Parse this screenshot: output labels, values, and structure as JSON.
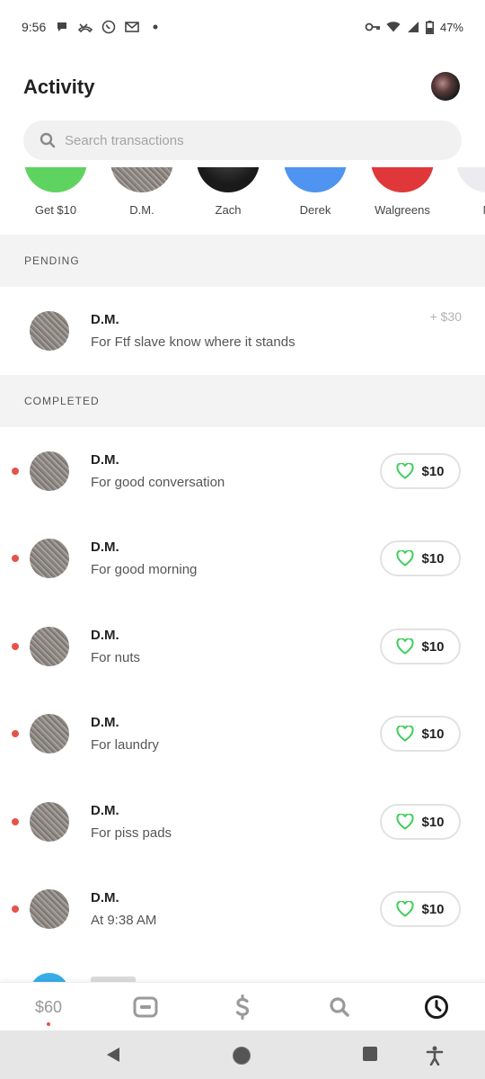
{
  "status_bar": {
    "time": "9:56",
    "battery": "47%",
    "left_icons": [
      "chat-bubble-icon",
      "missed-call-icon",
      "whatsapp-icon",
      "gmail-icon",
      "dot-icon"
    ],
    "right_icons": [
      "vpn-key-icon",
      "wifi-icon",
      "cell-signal-icon",
      "battery-icon"
    ]
  },
  "header": {
    "title": "Activity"
  },
  "search": {
    "placeholder": "Search transactions"
  },
  "contacts": [
    {
      "name": "Get $10",
      "color": "#5fd35f"
    },
    {
      "name": "D.M.",
      "color": "#8f8a86"
    },
    {
      "name": "Zach",
      "color": "#1a1a1a"
    },
    {
      "name": "Derek",
      "color": "#4f94f0"
    },
    {
      "name": "Walgreens",
      "color": "#e0383a"
    },
    {
      "name": "M",
      "color": "#ececf0"
    }
  ],
  "pending": {
    "header": "PENDING",
    "items": [
      {
        "name": "D.M.",
        "memo": "For Ftf slave know where it stands",
        "amount": "+ $30"
      }
    ]
  },
  "completed": {
    "header": "COMPLETED",
    "items": [
      {
        "name": "D.M.",
        "memo": "For good conversation",
        "amount": "$10"
      },
      {
        "name": "D.M.",
        "memo": "For good morning",
        "amount": "$10"
      },
      {
        "name": "D.M.",
        "memo": "For nuts",
        "amount": "$10"
      },
      {
        "name": "D.M.",
        "memo": "For laundry",
        "amount": "$10"
      },
      {
        "name": "D.M.",
        "memo": "For piss pads",
        "amount": "$10"
      },
      {
        "name": "D.M.",
        "memo": "At 9:38 AM",
        "amount": "$10"
      }
    ]
  },
  "bottom_nav": {
    "balance": "$60",
    "items": [
      "balance-tab",
      "card-icon",
      "dollar-icon",
      "search-icon",
      "clock-icon"
    ]
  },
  "system_nav": {
    "items": [
      "back-icon",
      "home-icon",
      "recents-icon",
      "accessibility-icon"
    ]
  },
  "colors": {
    "accent_green": "#3ecf5a",
    "unread_dot": "#e5534b"
  }
}
